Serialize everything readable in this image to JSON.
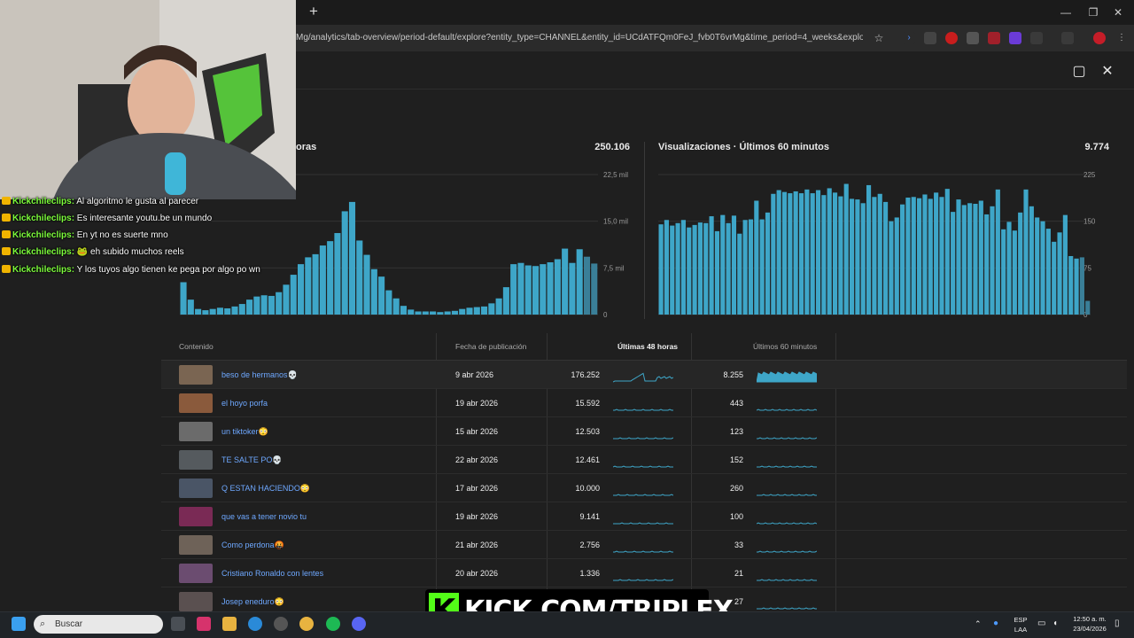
{
  "browser": {
    "new_tab": "+",
    "url": "Mg/analytics/tab-overview/period-default/explore?entity_type=CHANNEL&entity_id=UCdATFQm0FeJ_fvb0T6vrMg&time_period=4_weeks&explore_type...",
    "controls": {
      "minimize": "—",
      "restore": "❐",
      "close": "✕"
    }
  },
  "panel": {
    "feedback_icon": "feedback-icon",
    "close_icon": "close-icon"
  },
  "chart_data": [
    {
      "type": "bar",
      "title": "oras",
      "total": "250.106",
      "ytick_labels": [
        "22,5 mil",
        "15,0 mil",
        "7,5 mil",
        "0"
      ],
      "ylim": [
        0,
        22500
      ],
      "values": [
        5200,
        2400,
        900,
        700,
        900,
        1100,
        1000,
        1300,
        1700,
        2400,
        2900,
        3100,
        3000,
        3600,
        4800,
        6400,
        8100,
        9200,
        9700,
        11100,
        11800,
        13100,
        16600,
        18100,
        11900,
        9600,
        7300,
        6100,
        3900,
        2600,
        1400,
        800,
        500,
        500,
        500,
        400,
        500,
        600,
        900,
        1100,
        1200,
        1300,
        1800,
        2600,
        4400,
        8100,
        8300,
        7900,
        7800,
        8100,
        8400,
        8900,
        10600,
        8300,
        10500,
        9300,
        8200
      ]
    },
    {
      "type": "bar",
      "title": "Visualizaciones · Últimos 60 minutos",
      "total": "9.774",
      "ytick_labels": [
        "225",
        "150",
        "75",
        "0"
      ],
      "ylim": [
        0,
        225
      ],
      "values": [
        145,
        152,
        143,
        147,
        152,
        140,
        144,
        148,
        147,
        158,
        134,
        160,
        147,
        159,
        130,
        152,
        153,
        183,
        153,
        164,
        194,
        200,
        197,
        195,
        198,
        195,
        201,
        195,
        200,
        192,
        203,
        196,
        190,
        210,
        186,
        185,
        179,
        208,
        189,
        194,
        181,
        150,
        156,
        177,
        188,
        189,
        187,
        193,
        186,
        196,
        189,
        202,
        165,
        185,
        176,
        179,
        178,
        183,
        161,
        174,
        201,
        137,
        149,
        135,
        164,
        201,
        174,
        156,
        150,
        138,
        117,
        132,
        160,
        94,
        90,
        92,
        22
      ]
    }
  ],
  "table": {
    "headers": {
      "content": "Contenido",
      "date": "Fecha de publicación",
      "h48": "Últimas 48 horas",
      "m60": "Últimos 60 minutos"
    },
    "rows": [
      {
        "title": "beso de hermanos💀",
        "date": "9 abr 2026",
        "h48": "176.252",
        "m60": "8.255"
      },
      {
        "title": "el hoyo porfa",
        "date": "19 abr 2026",
        "h48": "15.592",
        "m60": "443"
      },
      {
        "title": "un tiktoker😳",
        "date": "15 abr 2026",
        "h48": "12.503",
        "m60": "123"
      },
      {
        "title": "TE SALTE PO💀",
        "date": "22 abr 2026",
        "h48": "12.461",
        "m60": "152"
      },
      {
        "title": "Q ESTAN HACIENDO😳",
        "date": "17 abr 2026",
        "h48": "10.000",
        "m60": "260"
      },
      {
        "title": "que vas a tener novio tu",
        "date": "19 abr 2026",
        "h48": "9.141",
        "m60": "100"
      },
      {
        "title": "Como perdona🤬",
        "date": "21 abr 2026",
        "h48": "2.756",
        "m60": "33"
      },
      {
        "title": "Cristiano Ronaldo con lentes",
        "date": "20 abr 2026",
        "h48": "1.336",
        "m60": "21"
      },
      {
        "title": "Josep eneduro😳",
        "date": "",
        "h48": "",
        "m60": "27"
      }
    ]
  },
  "chat": [
    {
      "user": "Kickchileclips:",
      "text": " Al algoritmo le gusta al parecer"
    },
    {
      "user": "Kickchileclips:",
      "text": " Es interesante youtu.be un mundo"
    },
    {
      "user": "Kickchileclips:",
      "text": " En yt no es suerte mno"
    },
    {
      "user": "Kickchileclips:",
      "text": " 🐸 eh subido muchos reels"
    },
    {
      "user": "Kickchileclips:",
      "text": " Y los tuyos algo tienen ke pega por algo po wn"
    }
  ],
  "overlay": {
    "kick_logo": "K",
    "kick_text": "KICK.COM/TRIPLEX"
  },
  "taskbar": {
    "search_placeholder": "Buscar",
    "lang_top": "ESP",
    "lang_bottom": "LAA",
    "time": "12:50 a. m.",
    "date": "23/04/2026"
  },
  "colors": {
    "bar": "#3ea6c8",
    "link": "#6ea8ff",
    "chat_user": "#7cfc3b",
    "kick_green": "#53fc18"
  }
}
